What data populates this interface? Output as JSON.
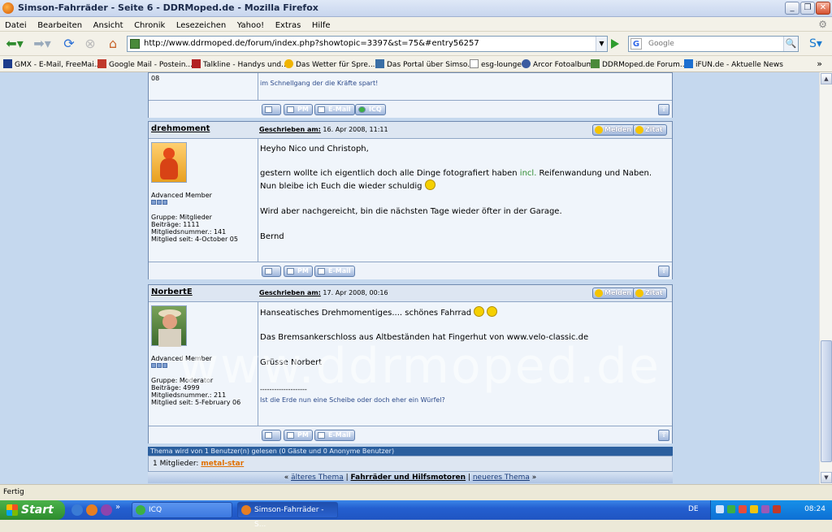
{
  "window": {
    "title": "Simson-Fahrräder - Seite 6 - DDRMoped.de - Mozilla Firefox"
  },
  "menu": [
    "Datei",
    "Bearbeiten",
    "Ansicht",
    "Chronik",
    "Lesezeichen",
    "Yahoo!",
    "Extras",
    "Hilfe"
  ],
  "nav": {
    "url": "http://www.ddrmoped.de/forum/index.php?showtopic=3397&st=75&#entry56257",
    "search_placeholder": "Google"
  },
  "bookmarks": [
    {
      "label": "GMX - E-Mail, FreeMai...",
      "color": "#1c3c8c"
    },
    {
      "label": "Google Mail - Postein...",
      "color": "#c0392b"
    },
    {
      "label": "Talkline - Handys und...",
      "color": "#b22222"
    },
    {
      "label": "Das Wetter für Spre...",
      "color": "#f0b400"
    },
    {
      "label": "Das Portal über Simso...",
      "color": "#3a6ea5"
    },
    {
      "label": "esg-lounge",
      "color": "#ffffff"
    },
    {
      "label": "Arcor Fotoalbum",
      "color": "#3a5ba0"
    },
    {
      "label": "DDRMoped.de Forum...",
      "color": "#4a8a3a"
    },
    {
      "label": "iFUN.de - Aktuelle News",
      "color": "#1c6fd0"
    }
  ],
  "post0": {
    "number": "08",
    "signature": "im Schnellgang der die Kräfte spart!"
  },
  "post1": {
    "author": "drehmoment",
    "written_label": "Geschrieben am:",
    "written_date": "16. Apr 2008, 11:11",
    "rank": "Advanced Member",
    "group": "Gruppe: Mitglieder",
    "posts": "Beiträge: 1111",
    "member_no": "Mitgliedsnummer.: 141",
    "member_since": "Mitglied seit: 4-October 05",
    "line1": "Heyho Nico und Christoph,",
    "line2a": "gestern wollte ich eigentlich doch alle Dinge fotografiert haben ",
    "line2b": "incl.",
    "line2c": " Reifenwandung und Naben.",
    "line3": "Nun bleibe ich Euch die wieder schuldig",
    "line4": "Wird aber nachgereicht, bin die nächsten Tage wieder öfter in der Garage.",
    "line5": "Bernd"
  },
  "post2": {
    "author": "NorbertE",
    "written_label": "Geschrieben am:",
    "written_date": "17. Apr 2008, 00:16",
    "rank": "Advanced Member",
    "group": "Gruppe: Moderator",
    "posts": "Beiträge: 4999",
    "member_no": "Mitgliedsnummer.: 211",
    "member_since": "Mitglied seit: 5-February 06",
    "line1": "Hanseatisches Drehmomentiges.... schönes Fahrrad",
    "line2": "Das Bremsankerschloss aus Altbeständen hat Fingerhut von www.velo-classic.de",
    "line3": "Grüsse Norbert",
    "sig_sep": "--------------------",
    "signature": "Ist die Erde nun eine Scheibe oder doch eher ein Würfel?"
  },
  "buttons": {
    "melden": "Melden",
    "zitat": "Zitat",
    "pm": "PM",
    "email": "E-Mail",
    "icq": "ICQ",
    "top": "⇧"
  },
  "watermark": "www.ddrmoped.de",
  "readers": "Thema wird von 1 Benutzer(n) gelesen (0 Gäste und 0 Anonyme Benutzer)",
  "members_label": "1 Mitglieder:",
  "members_name": "metal-star",
  "threadnav": {
    "prev": "älteres Thema",
    "current": "Fahrräder und Hilfsmotoren",
    "next": "neueres Thema"
  },
  "status": "Fertig",
  "taskbar": {
    "start": "Start",
    "task1": "ICQ",
    "task2": "Simson-Fahrräder - S...",
    "lang": "DE",
    "clock": "08:24"
  }
}
